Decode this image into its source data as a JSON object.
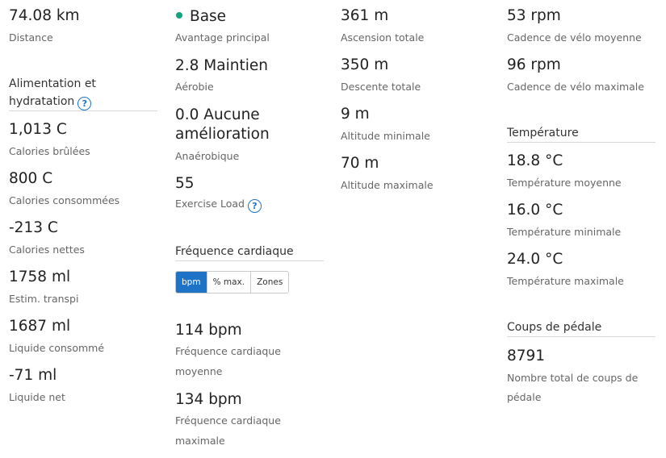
{
  "col1": {
    "distance": {
      "value": "74.08 km",
      "label": "Distance"
    },
    "nutrition_header_line1": "Alimentation et",
    "nutrition_header_line2": "hydratation",
    "nutrition_help_icon": "question-circle-icon",
    "stats": [
      {
        "value": "1,013 C",
        "label": "Calories brûlées"
      },
      {
        "value": "800 C",
        "label": "Calories consommées"
      },
      {
        "value": "-213 C",
        "label": "Calories nettes"
      },
      {
        "value": "1758 ml",
        "label": "Estim. transpi"
      },
      {
        "value": "1687 ml",
        "label": "Liquide consommé"
      },
      {
        "value": "-71 ml",
        "label": "Liquide net"
      }
    ]
  },
  "col2": {
    "primary_benefit": {
      "value": "Base",
      "label": "Avantage principal",
      "dot_color": "#14a37f"
    },
    "aerobic": {
      "value": "2.8 Maintien",
      "label": "Aérobie"
    },
    "anaerobic": {
      "value_line1": "0.0 Aucune",
      "value_line2": "amélioration",
      "label": "Anaérobique"
    },
    "exercise_load": {
      "value": "55",
      "label": "Exercise Load"
    },
    "hr_header": "Fréquence cardiaque",
    "hr_tabs": [
      "bpm",
      "% max.",
      "Zones"
    ],
    "hr_active_tab": "bpm",
    "hr_avg": {
      "value": "114 bpm",
      "label_line1": "Fréquence cardiaque",
      "label_line2": "moyenne"
    },
    "hr_max": {
      "value": "134 bpm",
      "label_line1": "Fréquence cardiaque",
      "label_line2": "maximale"
    }
  },
  "col3": {
    "stats": [
      {
        "value": "361 m",
        "label": "Ascension totale"
      },
      {
        "value": "350 m",
        "label": "Descente totale"
      },
      {
        "value": "9 m",
        "label": "Altitude minimale"
      },
      {
        "value": "70 m",
        "label": "Altitude maximale"
      }
    ]
  },
  "col4": {
    "cadence": [
      {
        "value": "53 rpm",
        "label": "Cadence de vélo moyenne"
      },
      {
        "value": "96 rpm",
        "label": "Cadence de vélo maximale"
      }
    ],
    "temp_header": "Température",
    "temps": [
      {
        "value": "18.8 °C",
        "label": "Température moyenne"
      },
      {
        "value": "16.0 °C",
        "label": "Température minimale"
      },
      {
        "value": "24.0 °C",
        "label": "Température maximale"
      }
    ],
    "strokes_header": "Coups de pédale",
    "strokes": {
      "value": "8791",
      "label_line1": "Nombre total de coups de",
      "label_line2": "pédale"
    }
  },
  "accent_color": "#1f73c6"
}
